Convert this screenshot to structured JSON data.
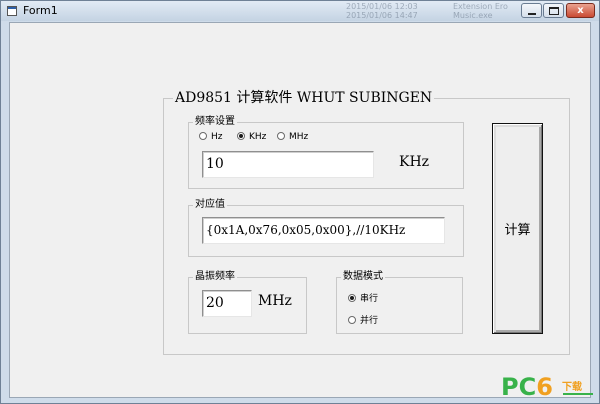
{
  "window": {
    "title": "Form1",
    "close_glyph": "x",
    "icons": [
      "app-icon",
      "minimize-icon",
      "maximize-icon",
      "close-icon"
    ]
  },
  "background_window": {
    "lines": [
      "2015/01/06 12:03",
      "2015/01/06 14:47",
      "Extension Ero",
      "Music.exe"
    ]
  },
  "main_group": {
    "title": "AD9851 计算软件 WHUT SUBINGEN"
  },
  "frequency_setting": {
    "title": "频率设置",
    "options": [
      "Hz",
      "KHz",
      "MHz"
    ],
    "selected": "KHz",
    "value": "10",
    "unit": "KHz"
  },
  "corresponding_value": {
    "title": "对应值",
    "value": "{0x1A,0x76,0x05,0x00},//10KHz"
  },
  "crystal_frequency": {
    "title": "晶振频率",
    "value": "20",
    "unit": "MHz"
  },
  "data_mode": {
    "title": "数据模式",
    "options": [
      "串行",
      "并行"
    ],
    "selected": "串行"
  },
  "calculate_button": {
    "label": "计算"
  },
  "watermark": {
    "pc": "PC",
    "six": "6",
    "cn": "下载"
  },
  "colors": {
    "window_frame": "#cfdcea",
    "client_background": "#f0f0f0",
    "close_button": "#c94a33",
    "watermark_green": "#38b24a",
    "watermark_orange": "#f0a020"
  }
}
